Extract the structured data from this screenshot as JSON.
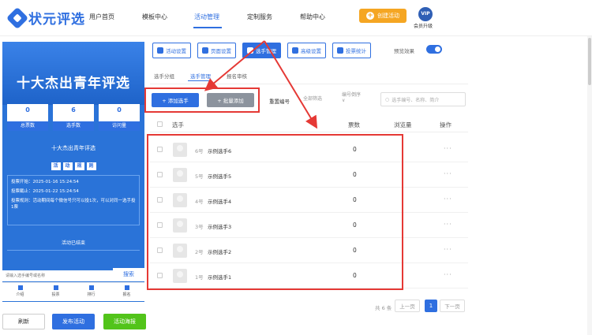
{
  "header": {
    "logo": "状元评选",
    "nav": [
      "用户首页",
      "模板中心",
      "活动管理",
      "定制服务",
      "帮助中心"
    ],
    "create_label": "创建活动",
    "vip_badge": "VIP",
    "vip_label": "会员升级"
  },
  "preview": {
    "title": "十大杰出青年评选",
    "stats": [
      {
        "value": "0",
        "label": "总票数"
      },
      {
        "value": "6",
        "label": "选手数"
      },
      {
        "value": "0",
        "label": "访问量"
      }
    ],
    "subtitle": "十大杰出青年评选",
    "rules_chars": [
      "活",
      "动",
      "规",
      "则"
    ],
    "rules": [
      "投票开始：2025-01-16 15:24:54",
      "投票截止：2025-01-22 15:24:54",
      "投票规则：活动期间每个微信号只可以投1次，可以对同一选手投1票"
    ],
    "ended": "活动已结束",
    "search_placeholder": "请输入选手编号或名称",
    "search_btn": "搜索",
    "tabs": [
      "介绍",
      "投票",
      "排行",
      "报名"
    ]
  },
  "footer_buttons": {
    "refresh": "刷新",
    "publish": "发布活动",
    "poster": "活动海报"
  },
  "toolbar": {
    "buttons": [
      "活动设置",
      "页面设置",
      "选手管理",
      "高级设置",
      "投票统计"
    ],
    "preview_label": "预览效果"
  },
  "subtabs": [
    "选手分组",
    "选手管理",
    "报名审核"
  ],
  "actions": {
    "add": "+ 添加选手",
    "batch": "+ 批量添加",
    "reset_no": "重置编号",
    "filter": "全部筛选",
    "sort": "编号倒序",
    "search_placeholder": "选手编号、名称、简介"
  },
  "table": {
    "columns": [
      "选手",
      "票数",
      "浏览量",
      "操作"
    ],
    "rows": [
      {
        "no": "6号",
        "name": "示例选手6",
        "votes": "0",
        "more": "···"
      },
      {
        "no": "5号",
        "name": "示例选手5",
        "votes": "0",
        "more": "···"
      },
      {
        "no": "4号",
        "name": "示例选手4",
        "votes": "0",
        "more": "···"
      },
      {
        "no": "3号",
        "name": "示例选手3",
        "votes": "0",
        "more": "···"
      },
      {
        "no": "2号",
        "name": "示例选手2",
        "votes": "0",
        "more": "···"
      },
      {
        "no": "1号",
        "name": "示例选手1",
        "votes": "0",
        "more": "···"
      }
    ]
  },
  "pagination": {
    "total": "共 6 条",
    "prev": "上一页",
    "current": "1",
    "next": "下一页"
  },
  "colors": {
    "primary": "#2f6fe0",
    "accent": "#f5a623",
    "highlight": "#e53935"
  }
}
